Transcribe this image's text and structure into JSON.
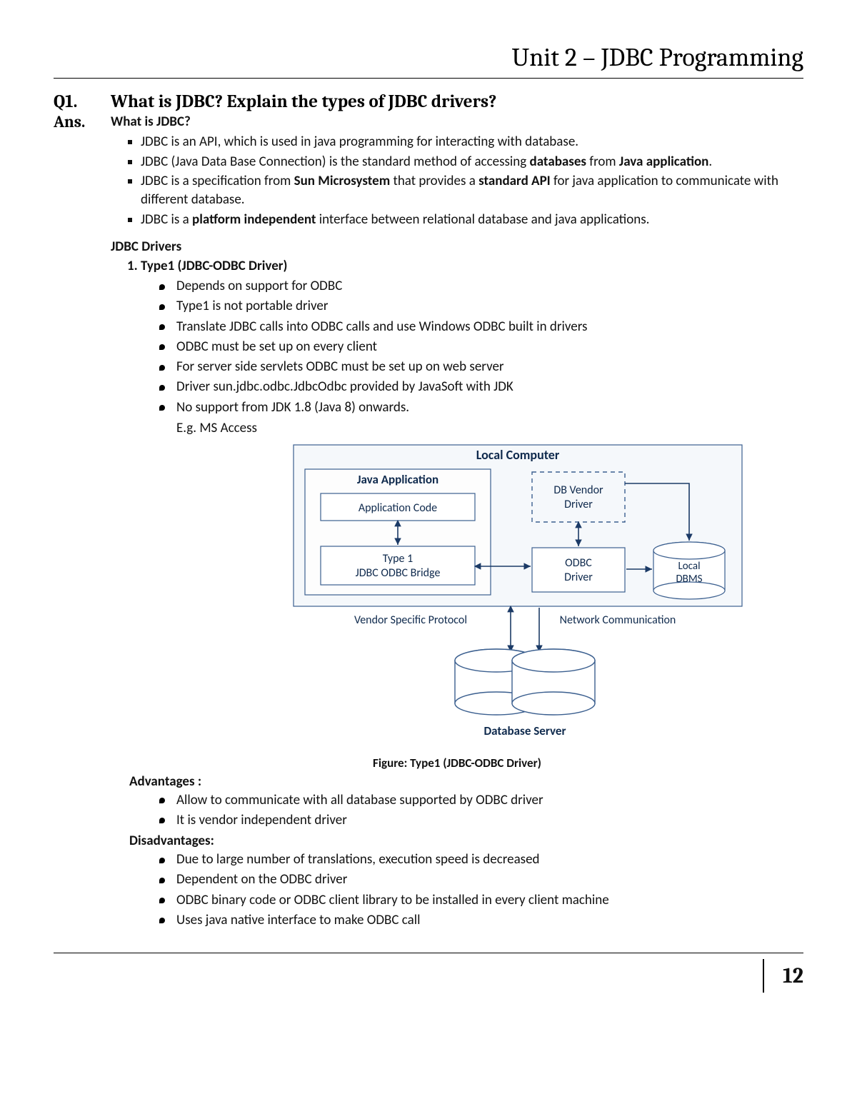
{
  "unitTitle": "Unit 2 – JDBC Programming",
  "q1": {
    "label": "Q1.",
    "text": "What is JDBC? Explain the types of JDBC drivers?"
  },
  "ansLabel": "Ans.",
  "section1": {
    "heading": "What is JDBC?",
    "items": [
      {
        "pre": "JDBC is an API, which is used in java programming for interacting with database."
      },
      {
        "pre": "JDBC (Java Data Base Connection) is the standard method of accessing ",
        "b1": "databases",
        "mid": " from ",
        "b2": "Java application",
        "post": "."
      },
      {
        "pre": "JDBC is a specification from ",
        "b1": "Sun Microsystem",
        "mid": " that provides a ",
        "b2": "standard API",
        "post": " for java application to communicate with different database."
      },
      {
        "pre": "JDBC is a ",
        "b1": "platform independent",
        "post": " interface between relational database and java applications."
      }
    ]
  },
  "driversHeading": "JDBC Drivers",
  "type1": {
    "number": "1.",
    "title": "Type1 (JDBC-ODBC Driver)",
    "points": [
      "Depends on support for ODBC",
      "Type1 is not portable driver",
      "Translate JDBC calls into ODBC calls and use Windows ODBC built in drivers",
      "ODBC must be set up on every client",
      "For server side servlets ODBC must be set up on web server",
      "Driver sun.jdbc.odbc.JdbcOdbc provided by JavaSoft with JDK",
      "No support from JDK 1.8 (Java 8) onwards."
    ],
    "eg": "E.g. MS Access"
  },
  "diagram": {
    "localComputer": "Local Computer",
    "javaApp": "Java Application",
    "appCode": "Application Code",
    "bridge1": "Type 1",
    "bridge2": "JDBC ODBC Bridge",
    "dbVendor1": "DB Vendor",
    "dbVendor2": "Driver",
    "odbc1": "ODBC",
    "odbc2": "Driver",
    "local1": "Local",
    "local2": "DBMS",
    "vsp": "Vendor Specific Protocol",
    "net": "Network Communication",
    "dbServer": "Database Server"
  },
  "figureCaption": "Figure: Type1 (JDBC-ODBC Driver)",
  "advantages": {
    "heading": "Advantages :",
    "items": [
      "Allow  to communicate with all database supported by ODBC driver",
      "It is vendor independent driver"
    ]
  },
  "disadvantages": {
    "heading": "Disadvantages:",
    "items": [
      "Due to large number of translations, execution speed is decreased",
      "Dependent on the ODBC driver",
      "ODBC binary code or ODBC client library to be installed in every client machine",
      "Uses java native interface to make ODBC call"
    ]
  },
  "pageNumber": "12"
}
